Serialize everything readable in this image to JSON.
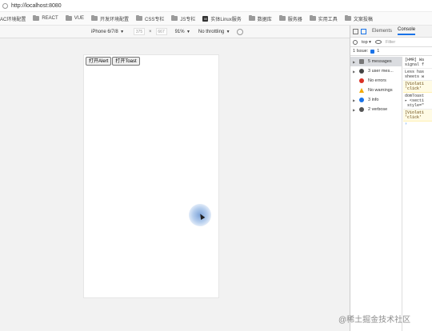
{
  "browser": {
    "url": "http://localhost:8080",
    "bookmarks": [
      {
        "label": "AC环境配置",
        "icon": "folder-icon"
      },
      {
        "label": "REACT",
        "icon": "folder-icon"
      },
      {
        "label": "VUE",
        "icon": "folder-icon"
      },
      {
        "label": "开发环境配置",
        "icon": "folder-icon"
      },
      {
        "label": "CSS专栏",
        "icon": "folder-icon"
      },
      {
        "label": "JS专栏",
        "icon": "folder-icon"
      },
      {
        "label": "实体Linux服务",
        "icon": "badge-icon"
      },
      {
        "label": "数据库",
        "icon": "folder-icon"
      },
      {
        "label": "服务器",
        "icon": "folder-icon"
      },
      {
        "label": "实用工具",
        "icon": "folder-icon"
      },
      {
        "label": "文案投稿",
        "icon": "folder-icon"
      }
    ]
  },
  "device_toolbar": {
    "device": "iPhone 6/7/8",
    "width": "375",
    "height": "667",
    "zoom": "91%",
    "throttling": "No throttling"
  },
  "page": {
    "alert_button": "打开Alert",
    "toast_button": "打开Toast"
  },
  "devtools": {
    "tab_elements": "Elements",
    "tab_console": "Console",
    "context": "top",
    "filter_placeholder": "Filter",
    "issues_label": "1 Issue:",
    "issues_count": "1",
    "sidebar": [
      "5 messages",
      "3 user mes...",
      "No errors",
      "No warnings",
      "3 info",
      "2 verbose"
    ],
    "console_lines": [
      {
        "text": "[HMR] Wa\nsignal f",
        "type": "log"
      },
      {
        "text": "Less has\nsheets w",
        "type": "log"
      },
      {
        "text": "[Violati\n'click'",
        "type": "violation"
      },
      {
        "text": "domToast\n▸ <secti\n style=\"",
        "type": "log"
      },
      {
        "text": "[Violati\n'click'",
        "type": "violation"
      }
    ]
  },
  "watermark": "@稀土掘金技术社区",
  "colors": {
    "accent": "#1a73e8",
    "error": "#d93025",
    "warning": "#f2a900",
    "touch_indicator": "#78a0d7"
  }
}
